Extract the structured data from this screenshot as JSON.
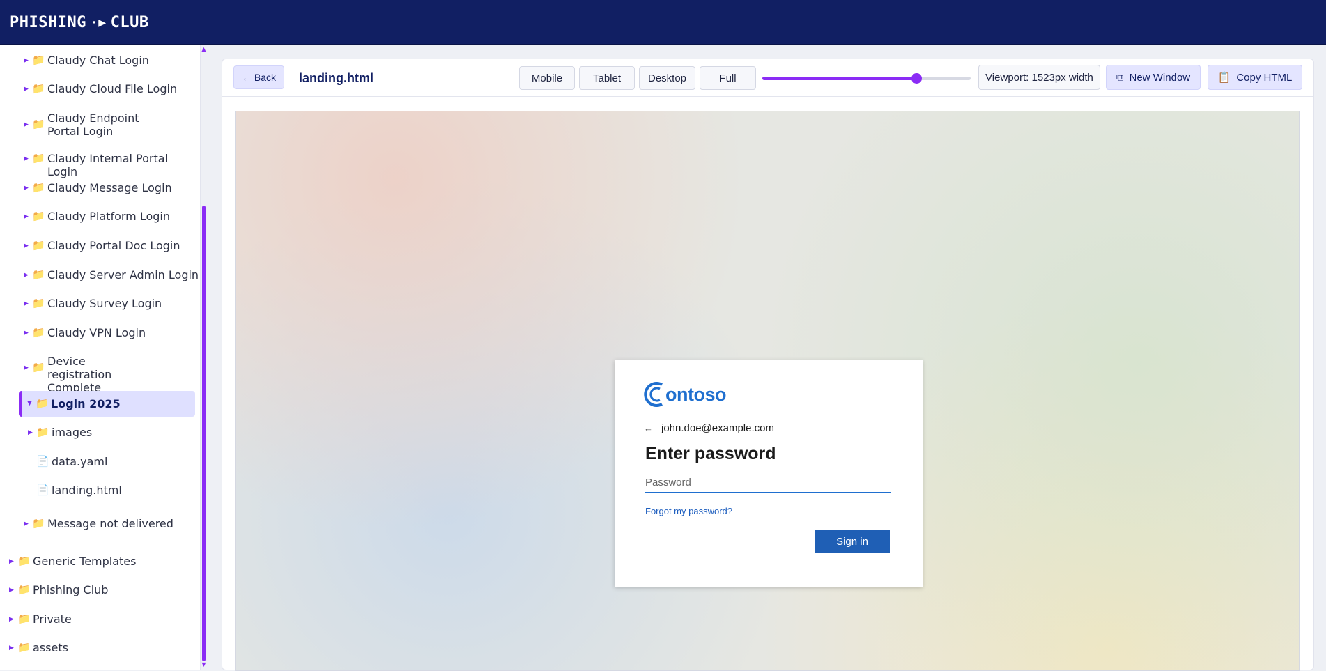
{
  "header": {
    "logo_left": "PHISHING",
    "logo_right": "CLUB"
  },
  "sidebar": {
    "items": [
      {
        "label": "Claudy Chat Login",
        "icon": "folder-icon",
        "expanded": false
      },
      {
        "label": "Claudy Cloud File Login",
        "icon": "folder-icon",
        "expanded": false
      },
      {
        "label": "Claudy Endpoint Portal Login",
        "icon": "folder-icon",
        "expanded": false
      },
      {
        "label": "Claudy Internal Portal Login",
        "icon": "folder-icon",
        "expanded": false
      },
      {
        "label": "Claudy Message Login",
        "icon": "folder-icon",
        "expanded": false
      },
      {
        "label": "Claudy Platform Login",
        "icon": "folder-icon",
        "expanded": false
      },
      {
        "label": "Claudy Portal Doc Login",
        "icon": "folder-icon",
        "expanded": false
      },
      {
        "label": "Claudy Server Admin Login",
        "icon": "folder-icon",
        "expanded": false
      },
      {
        "label": "Claudy Survey Login",
        "icon": "folder-icon",
        "expanded": false
      },
      {
        "label": "Claudy VPN Login",
        "icon": "folder-icon",
        "expanded": false
      },
      {
        "label": "Device registration Complete",
        "icon": "folder-icon",
        "expanded": false
      },
      {
        "label": "Login 2025",
        "icon": "folder-icon",
        "expanded": true,
        "selected": true
      },
      {
        "label": "images",
        "icon": "folder-icon",
        "expanded": false
      },
      {
        "label": "data.yaml",
        "icon": "file-icon"
      },
      {
        "label": "landing.html",
        "icon": "file-icon"
      },
      {
        "label": "Message not delivered",
        "icon": "folder-icon",
        "expanded": false
      },
      {
        "label": "Generic Templates",
        "icon": "folder-icon",
        "expanded": false
      },
      {
        "label": "Phishing Club",
        "icon": "folder-icon",
        "expanded": false
      },
      {
        "label": "Private",
        "icon": "folder-icon",
        "expanded": false
      },
      {
        "label": "assets",
        "icon": "folder-icon",
        "expanded": false
      }
    ]
  },
  "toolbar": {
    "back_label": "← Back",
    "filename": "landing.html",
    "device_buttons": [
      "Mobile",
      "Tablet",
      "Desktop",
      "Full"
    ],
    "slider_fraction": 0.74,
    "viewport_label": "Viewport: 1523px width",
    "new_window_label": "New Window",
    "copy_html_label": "Copy HTML"
  },
  "preview": {
    "brand": "ontoso",
    "email": "john.doe@example.com",
    "heading": "Enter password",
    "password_placeholder": "Password",
    "forgot_link": "Forgot my password?",
    "signin_label": "Sign in"
  },
  "colors": {
    "header_bg": "#111f63",
    "accent": "#8b2cf5",
    "brand_blue": "#1f6fcf",
    "signin_bg": "#1f5fb5"
  }
}
